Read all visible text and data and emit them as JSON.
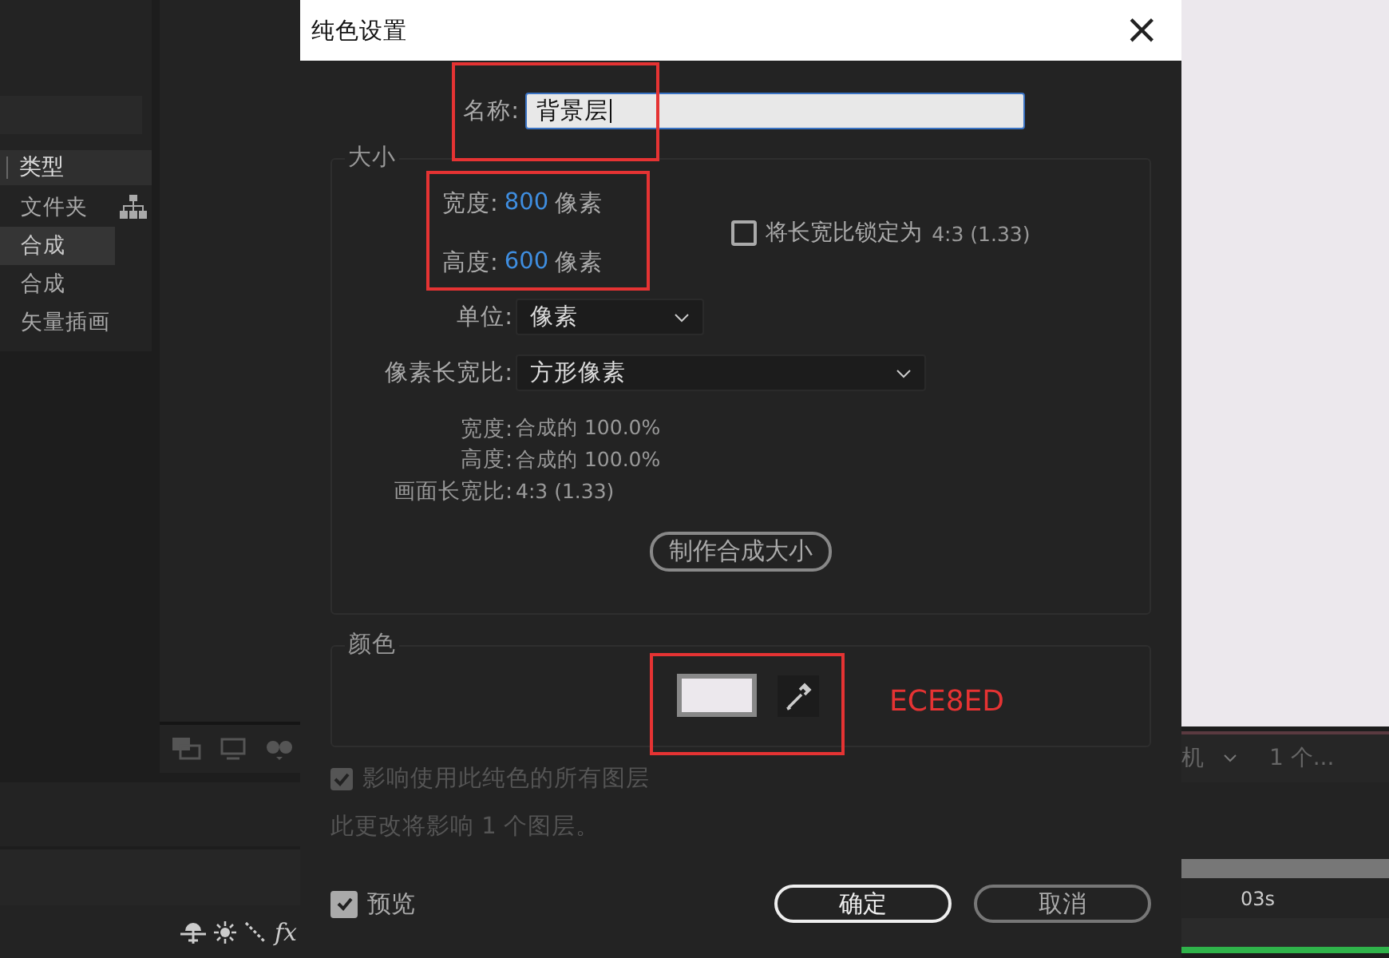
{
  "project_panel": {
    "column_header": "类型",
    "rows": [
      {
        "label": "文件夹",
        "selected": false
      },
      {
        "label": "合成",
        "selected": true
      },
      {
        "label": "合成",
        "selected": false
      },
      {
        "label": "矢量插画",
        "selected": false
      }
    ]
  },
  "timeline": {
    "switch_label": "fx",
    "time_label": "03s"
  },
  "viewer_toolbar": {
    "camera_label": "机",
    "view_label": "1 个..."
  },
  "dialog": {
    "title": "纯色设置",
    "close": "×",
    "name": {
      "label": "名称:",
      "value": "背景层"
    },
    "size": {
      "title": "大小",
      "width": {
        "label": "宽度:",
        "value": "800",
        "unit": "像素"
      },
      "height": {
        "label": "高度:",
        "value": "600",
        "unit": "像素"
      },
      "lock_aspect": {
        "label": "将长宽比锁定为",
        "ratio": "4:3 (1.33)",
        "checked": false
      },
      "units": {
        "label": "单位:",
        "value": "像素"
      },
      "pixel_aspect": {
        "label": "像素长宽比:",
        "value": "方形像素"
      },
      "info": [
        {
          "label": "宽度:",
          "value": "合成的 100.0%"
        },
        {
          "label": "高度:",
          "value": "合成的 100.0%"
        },
        {
          "label": "画面长宽比:",
          "value": "4:3 (1.33)"
        }
      ],
      "make_comp_size_button": "制作合成大小"
    },
    "color_group": {
      "title": "颜色",
      "color": "#ece8ed"
    },
    "affect_all": {
      "label": "影响使用此纯色的所有图层",
      "checked": true,
      "disabled": true
    },
    "note": "此更改将影响 1 个图层。",
    "preview": {
      "label": "预览",
      "checked": true
    },
    "buttons": [
      {
        "label": "确定",
        "kind": "default"
      },
      {
        "label": "取消",
        "kind": "normal"
      }
    ]
  },
  "annotation": {
    "text": "ECE8ED"
  }
}
